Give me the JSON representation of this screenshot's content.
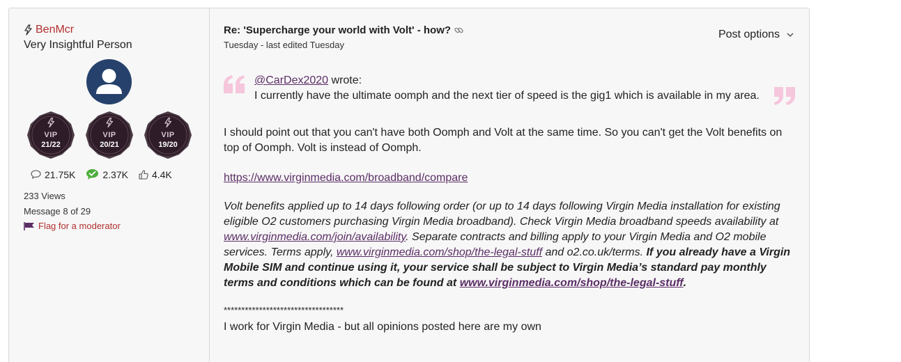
{
  "colors": {
    "accent": "#b32e2e",
    "link": "#5b2e66",
    "badge": "#2e1c28",
    "avatar": "#26416b",
    "quote_mark": "#f5c6dc"
  },
  "author": {
    "username": "BenMcr",
    "rank": "Very Insightful Person",
    "badges": [
      {
        "label": "VIP",
        "year": "21/22",
        "icon": "bolt-icon"
      },
      {
        "label": "VIP",
        "year": "20/21",
        "icon": "bolt-icon"
      },
      {
        "label": "VIP",
        "year": "19/20",
        "icon": "bolt-icon"
      }
    ],
    "stats": {
      "posts": "21.75K",
      "solutions": "2.37K",
      "kudos": "4.4K"
    },
    "views": "233 Views",
    "message_num": "Message 8 of 29",
    "flag_label": "Flag for a moderator"
  },
  "post": {
    "subject": "Re: 'Supercharge your world with Volt' - how?",
    "dates": "Tuesday - last edited Tuesday",
    "options_label": "Post options",
    "quote": {
      "author": "@CarDex2020",
      "wrote": " wrote:",
      "text": "I currently have the ultimate oomph and the next tier of speed is the gig1 which is available in my area."
    },
    "paragraph1": "I should point out that you can't have both Oomph and Volt at the same time. So you can't get the Volt benefits on top of Oomph. Volt is instead of Oomph.",
    "compare_link": "https://www.virginmedia.com/broadband/compare",
    "terms": {
      "t1": "Volt benefits applied up to 14 days following order (or up to 14 days following Virgin Media installation for existing eligible O2 customers purchasing Virgin Media broadband). Check Virgin Media broadband speeds availability at ",
      "link1": "www.virginmedia.com/join/availability",
      "t2": ". Separate contracts and billing apply to your Virgin Media and O2 mobile services. Terms apply, ",
      "link2": "www.virginmedia.com/shop/the-legal-stuff",
      "t3": " and o2.co.uk/terms. ",
      "bold1": "If you already have a Virgin Mobile SIM and continue using it, your service shall be subject to Virgin Media’s standard pay monthly terms and conditions which can be found at ",
      "link3": "www.virginmedia.com/shop/the-legal-stuff",
      "bold2": "."
    },
    "stars": "**********************************",
    "signature": "I work for Virgin Media - but all opinions posted here are my own"
  }
}
